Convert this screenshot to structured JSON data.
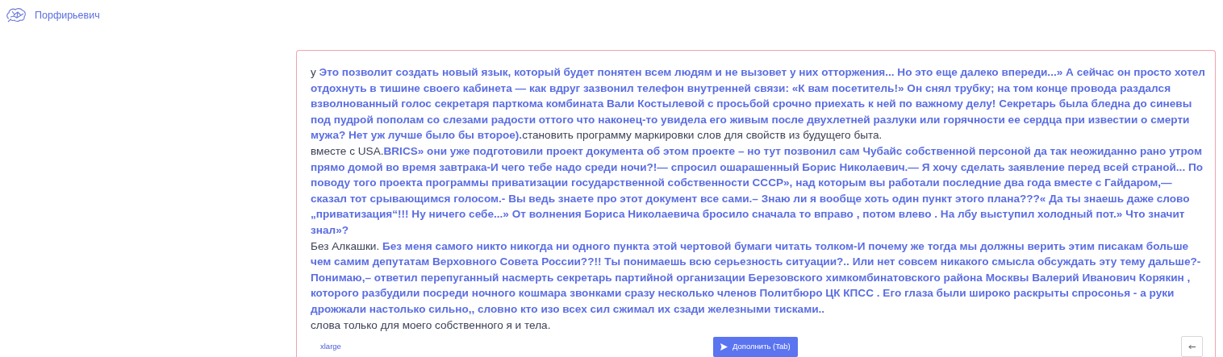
{
  "header": {
    "title": "Порфирьевич"
  },
  "editor": {
    "paragraphs": [
      "у **Это позволит создать новый язык, который будет понятен всем людям и не вызовет у них отторжения... Но это еще далеко впереди...» А сейчас он просто хотел отдохнуть в тишине своего кабинета — как вдруг зазвонил телефон внутренней связи: «К вам посетитель!» Он снял трубку; на том конце провода раздался взволнованный голос секретаря парткома комбината Вали Костылевой с просьбой срочно приехать к ней по важному делу! Секретарь была бледна до синевы под пудрой пополам со слезами радости оттого что наконец-то увидела его живым после двухлетней разлуки или горячности ее сердца при известии о смерти мужа? Нет уж лучше было бы второе).**становить программу маркировки слов для свойств из будущего быта.",
      "вместе с USA.**BRICS» они уже подготовили проект документа об этом проекте – но тут позвонил сам Чубайс собственной персоной да так неожиданно рано утром прямо домой во время завтрака-И чего тебе надо среди ночи?!— спросил ошарашенный Борис Николаевич.— Я хочу сделать заявление перед всей страной... По поводу того проекта программы приватизации государственной собственности СССР», над которым вы работали последние два года вместе с Гайдаром,— сказал тот срывающимся голосом.- Вы ведь знаете про этот документ все сами.– Знаю ли я вообще хоть один пункт этого плана???« Да ты знаешь даже слово „приватизация“!!! Ну ничего себе...» От волнения Бориса Николаевича бросило сначала то вправо , потом влево . На лбу выступил холодный пот.» Что значит знал»?**",
      "Без Алкашки. **Без меня самого никто никогда ни одного пункта этой чертовой бумаги читать толком-И почему же тогда мы должны верить этим писакам больше чем самим депутатам Верховного Совета России??!! Ты понимаешь всю серьезность ситуации?.. Или нет совсем никакого смысла обсуждать эту тему дальше?- Понимаю,– ответил перепуганный насмерть секретарь партийной организации Березовского химкомбинатовского района Москвы Валерий Иванович Корякин , которого разбудили посреди ночного кошмара звонками сразу несколько членов Политбюро ЦК КПСС . Его глаза были широко раскрыты спросонья - а руки дрожжали настолько сильно,, словно кто изо всех сил сжимал их сзади железными тисками..**",
      "слова только для моего собственного я и тела."
    ]
  },
  "footer": {
    "model_link": "xlarge",
    "submit_button": "Дополнить (Tab)"
  }
}
